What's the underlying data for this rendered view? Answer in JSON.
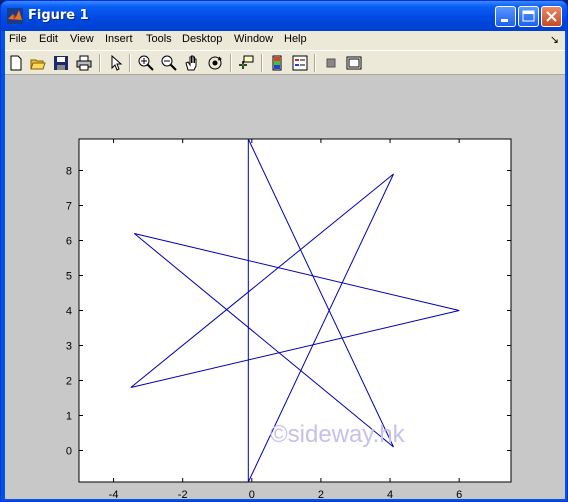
{
  "window": {
    "title": "Figure 1"
  },
  "menu": [
    "File",
    "Edit",
    "View",
    "Insert",
    "Tools",
    "Desktop",
    "Window",
    "Help"
  ],
  "menu_arrow": "↘",
  "toolbar": [
    "new-figure-icon",
    "open-file-icon",
    "save-icon",
    "print-icon",
    "arrow-pointer-icon",
    "zoom-in-icon",
    "zoom-out-icon",
    "pan-hand-icon",
    "rotate-3d-icon",
    "data-cursor-icon",
    "colorbar-icon",
    "legend-icon",
    "hide-plot-tools-icon",
    "show-plot-tools-icon"
  ],
  "watermark": "©sideway.hk",
  "colors": {
    "line": "#0000b0",
    "figure_bg": "#c8c8c8",
    "axes_bg": "#ffffff",
    "title_bar": "#0054e3"
  },
  "chart_data": {
    "type": "line",
    "grid": false,
    "xlim": [
      -5,
      7.5
    ],
    "ylim": [
      -0.9,
      8.9
    ],
    "xticks": [
      -4,
      -2,
      0,
      2,
      4,
      6
    ],
    "yticks": [
      0,
      1,
      2,
      3,
      4,
      5,
      6,
      7,
      8
    ],
    "series": [
      {
        "x": [
          -0.1,
          4.1,
          -3.5,
          6.0,
          -3.4,
          4.1,
          -0.1,
          -0.1
        ],
        "y": [
          -0.9,
          7.9,
          1.8,
          4.0,
          6.2,
          0.1,
          8.9,
          -0.9
        ]
      }
    ]
  }
}
